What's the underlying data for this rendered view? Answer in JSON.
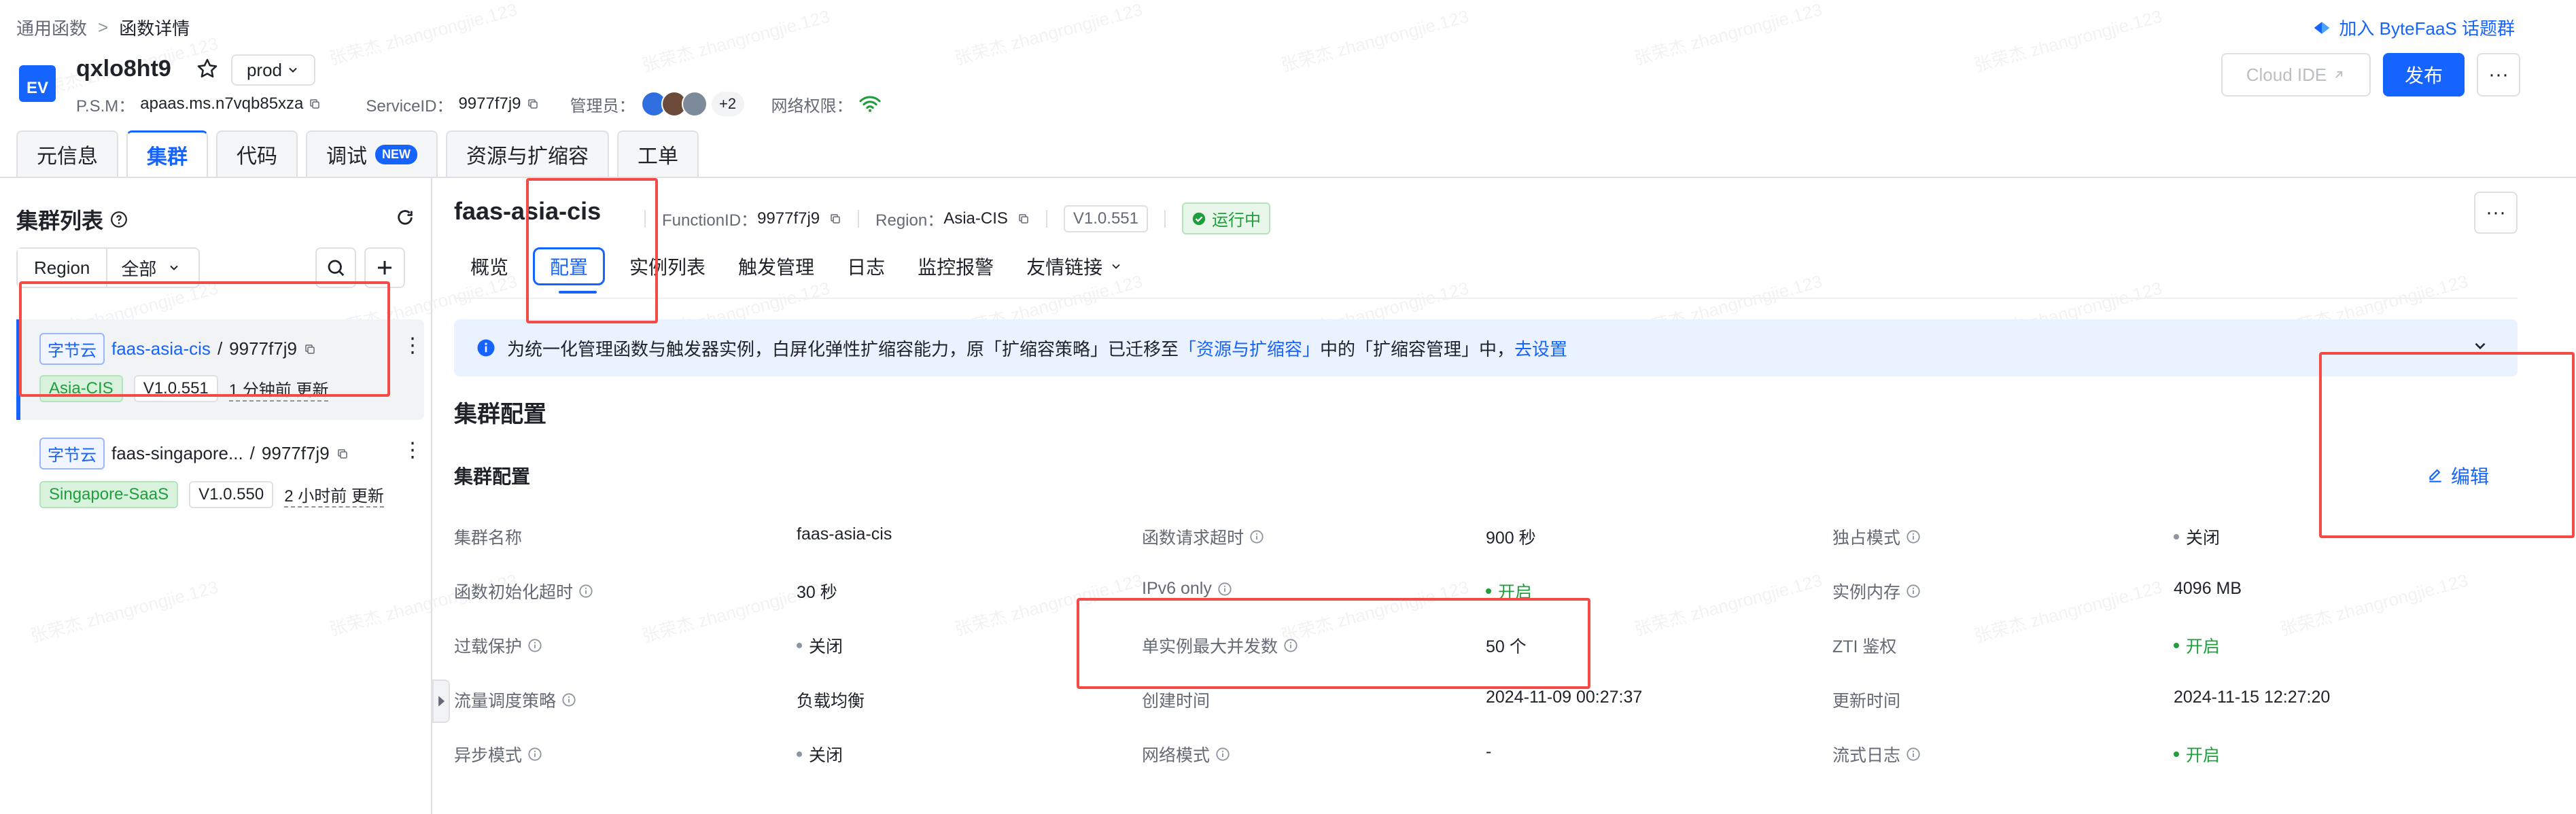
{
  "breadcrumb": {
    "root": "通用函数",
    "current": "函数详情"
  },
  "header": {
    "logo_text": "EV",
    "function_name": "qxlo8ht9",
    "env": "prod",
    "psm_label": "P.S.M：",
    "psm_value": "apaas.ms.n7vqb85xza",
    "service_id_label": "ServiceID：",
    "service_id_value": "9977f7j9",
    "admin_label": "管理员：",
    "admin_more": "+2",
    "network_label": "网络权限：",
    "join_link": "加入 ByteFaaS 话题群",
    "cloud_ide": "Cloud IDE",
    "publish": "发布"
  },
  "main_tabs": [
    {
      "label": "元信息"
    },
    {
      "label": "集群"
    },
    {
      "label": "代码"
    },
    {
      "label": "调试",
      "badge": "NEW"
    },
    {
      "label": "资源与扩缩容"
    },
    {
      "label": "工单"
    }
  ],
  "sidebar": {
    "title": "集群列表",
    "region_label": "Region",
    "region_value": "全部",
    "clusters": [
      {
        "vendor": "字节云",
        "name": "faas-asia-cis",
        "id": "9977f7j9",
        "region": "Asia-CIS",
        "version": "V1.0.551",
        "updated": "1 分钟前 更新"
      },
      {
        "vendor": "字节云",
        "name": "faas-singapore...",
        "id": "9977f7j9",
        "region": "Singapore-SaaS",
        "version": "V1.0.550",
        "updated": "2 小时前 更新"
      }
    ]
  },
  "cluster": {
    "name": "faas-asia-cis",
    "function_id_label": "FunctionID：",
    "function_id": "9977f7j9",
    "region_label": "Region：",
    "region": "Asia-CIS",
    "version": "V1.0.551",
    "status": "运行中"
  },
  "sub_tabs": [
    {
      "label": "概览"
    },
    {
      "label": "配置"
    },
    {
      "label": "实例列表"
    },
    {
      "label": "触发管理"
    },
    {
      "label": "日志"
    },
    {
      "label": "监控报警"
    },
    {
      "label": "友情链接"
    }
  ],
  "banner": {
    "text_pre": "为统一化管理函数与触发器实例，白屏化弹性扩缩容能力，原「扩缩容策略」已迁移至",
    "text_link": "「资源与扩缩容」",
    "text_post": "中的「扩缩容管理」中，",
    "action": "去设置"
  },
  "config": {
    "section_title": "集群配置",
    "subsection_title": "集群配置",
    "edit": "编辑",
    "rows": [
      [
        {
          "label": "集群名称",
          "info": false,
          "value": "faas-asia-cis",
          "dot": ""
        },
        {
          "label": "函数请求超时",
          "info": true,
          "value": "900 秒",
          "dot": ""
        },
        {
          "label": "独占模式",
          "info": true,
          "value": "关闭",
          "dot": "gray"
        }
      ],
      [
        {
          "label": "函数初始化超时",
          "info": true,
          "value": "30 秒",
          "dot": ""
        },
        {
          "label": "IPv6 only",
          "info": true,
          "value": "开启",
          "dot": "green"
        },
        {
          "label": "实例内存",
          "info": true,
          "value": "4096 MB",
          "dot": ""
        }
      ],
      [
        {
          "label": "过载保护",
          "info": true,
          "value": "关闭",
          "dot": "gray"
        },
        {
          "label": "单实例最大并发数",
          "info": true,
          "value": "50 个",
          "dot": ""
        },
        {
          "label": "ZTI 鉴权",
          "info": false,
          "value": "开启",
          "dot": "green"
        }
      ],
      [
        {
          "label": "流量调度策略",
          "info": true,
          "value": "负载均衡",
          "dot": ""
        },
        {
          "label": "创建时间",
          "info": false,
          "value": "2024-11-09 00:27:37",
          "dot": ""
        },
        {
          "label": "更新时间",
          "info": false,
          "value": "2024-11-15 12:27:20",
          "dot": ""
        }
      ],
      [
        {
          "label": "异步模式",
          "info": true,
          "value": "关闭",
          "dot": "gray"
        },
        {
          "label": "网络模式",
          "info": true,
          "value": "-",
          "dot": ""
        },
        {
          "label": "流式日志",
          "info": true,
          "value": "开启",
          "dot": "green"
        }
      ]
    ]
  },
  "watermark": "张荣杰 zhangrongjie.123",
  "colors": {
    "primary": "#1664ff",
    "success": "#1f9e3d",
    "annotation": "#f54a45"
  }
}
